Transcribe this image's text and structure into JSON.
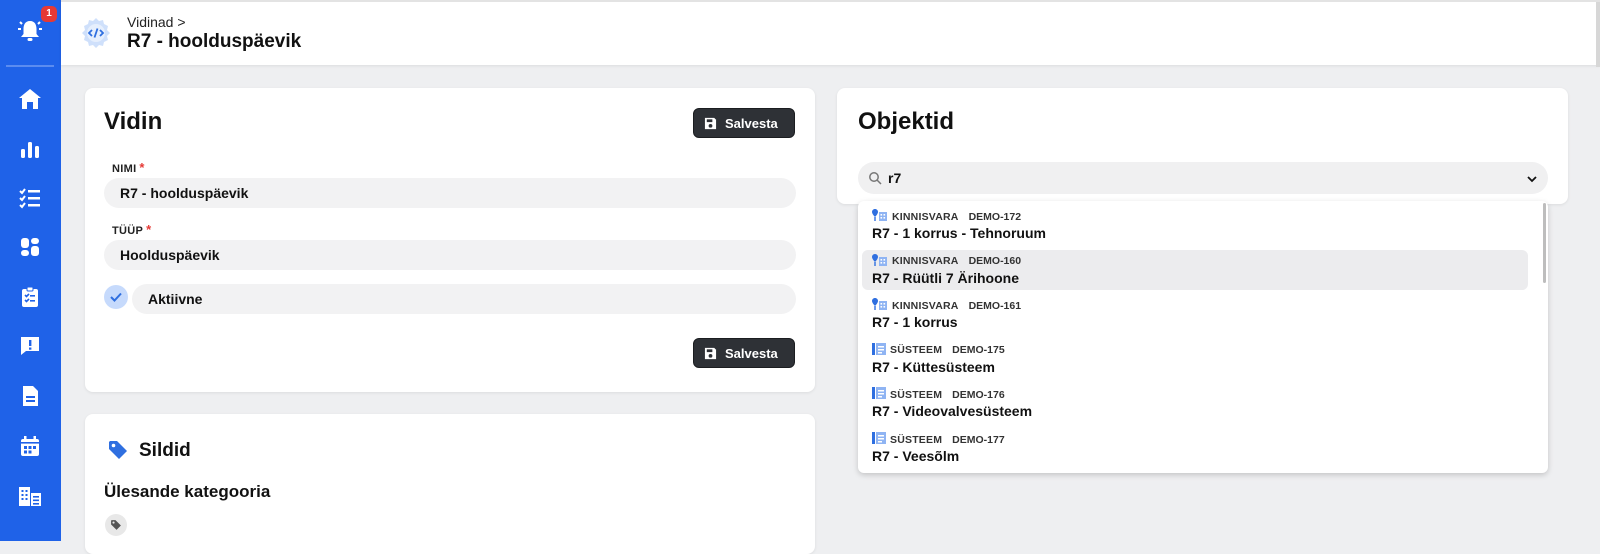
{
  "sidebar": {
    "notification_count": "1",
    "items": [
      {
        "icon": "home-icon"
      },
      {
        "icon": "bar-chart-icon"
      },
      {
        "icon": "checklist-icon"
      },
      {
        "icon": "dashboard-icon"
      },
      {
        "icon": "clipboard-check-icon"
      },
      {
        "icon": "feedback-icon"
      },
      {
        "icon": "document-icon"
      },
      {
        "icon": "calendar-icon"
      },
      {
        "icon": "buildings-icon"
      }
    ]
  },
  "header": {
    "breadcrumb": "Vidinad >",
    "title": "R7 - hoolduspäevik",
    "icon": "code-gear-icon"
  },
  "widget_card": {
    "title": "Vidin",
    "save_label": "Salvesta",
    "name_label": "NIMI",
    "name_value": "R7 - hoolduspäevik",
    "type_label": "TÜÜP",
    "type_value": "Hoolduspäevik",
    "active_label": "Aktiivne",
    "active_checked": true,
    "required_mark": "*"
  },
  "tags_card": {
    "title": "Sildid",
    "category_label": "Ülesande kategooria"
  },
  "objects_card": {
    "title": "Objektid",
    "search_value": "r7",
    "options": [
      {
        "kind": "KINNISVARA",
        "code": "DEMO-172",
        "name": "R7 - 1 korrus - Tehnoruum",
        "icon": "property-icon"
      },
      {
        "kind": "KINNISVARA",
        "code": "DEMO-160",
        "name": "R7 - Rüütli 7 Ärihoone",
        "icon": "property-icon",
        "highlighted": true
      },
      {
        "kind": "KINNISVARA",
        "code": "DEMO-161",
        "name": "R7 - 1 korrus",
        "icon": "property-icon"
      },
      {
        "kind": "SÜSTEEM",
        "code": "DEMO-175",
        "name": "R7 - Küttesüsteem",
        "icon": "system-icon"
      },
      {
        "kind": "SÜSTEEM",
        "code": "DEMO-176",
        "name": "R7 - Videovalvesüsteem",
        "icon": "system-icon"
      },
      {
        "kind": "SÜSTEEM",
        "code": "DEMO-177",
        "name": "R7 - Veesõlm",
        "icon": "system-icon"
      }
    ]
  },
  "colors": {
    "sidebar": "#1f62e8",
    "button_dark": "#2e3136",
    "required": "#e53935",
    "check_bg": "#c6dafc",
    "accent": "#2f6fe0"
  }
}
